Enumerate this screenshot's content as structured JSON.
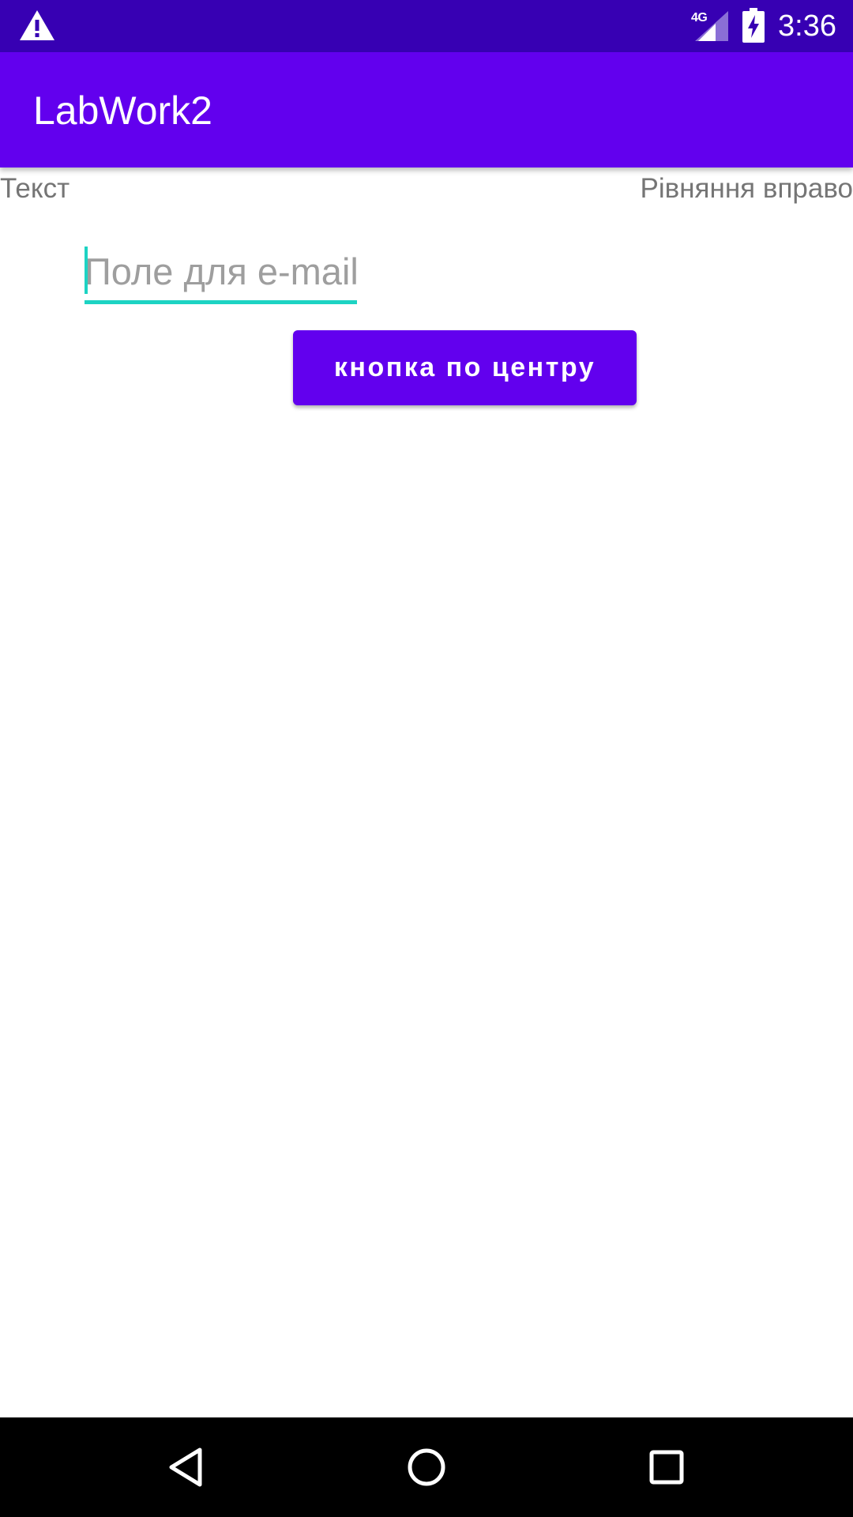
{
  "status_bar": {
    "time": "3:36",
    "network": "4G",
    "icons": [
      "warning-icon",
      "signal-icon",
      "battery-charging-icon"
    ],
    "background": "#3700B3"
  },
  "app_bar": {
    "title": "LabWork2",
    "background": "#6200EE"
  },
  "content": {
    "text_left": "Текст",
    "text_right": "Рівняння вправо",
    "email_field": {
      "placeholder": "Поле для e-mail",
      "value": "",
      "accent": "#1DD3C3"
    },
    "center_button": {
      "label": "кнопка по центру",
      "background": "#6200EE"
    }
  },
  "nav_bar": {
    "icons": [
      "back-icon",
      "home-icon",
      "recents-icon"
    ]
  }
}
